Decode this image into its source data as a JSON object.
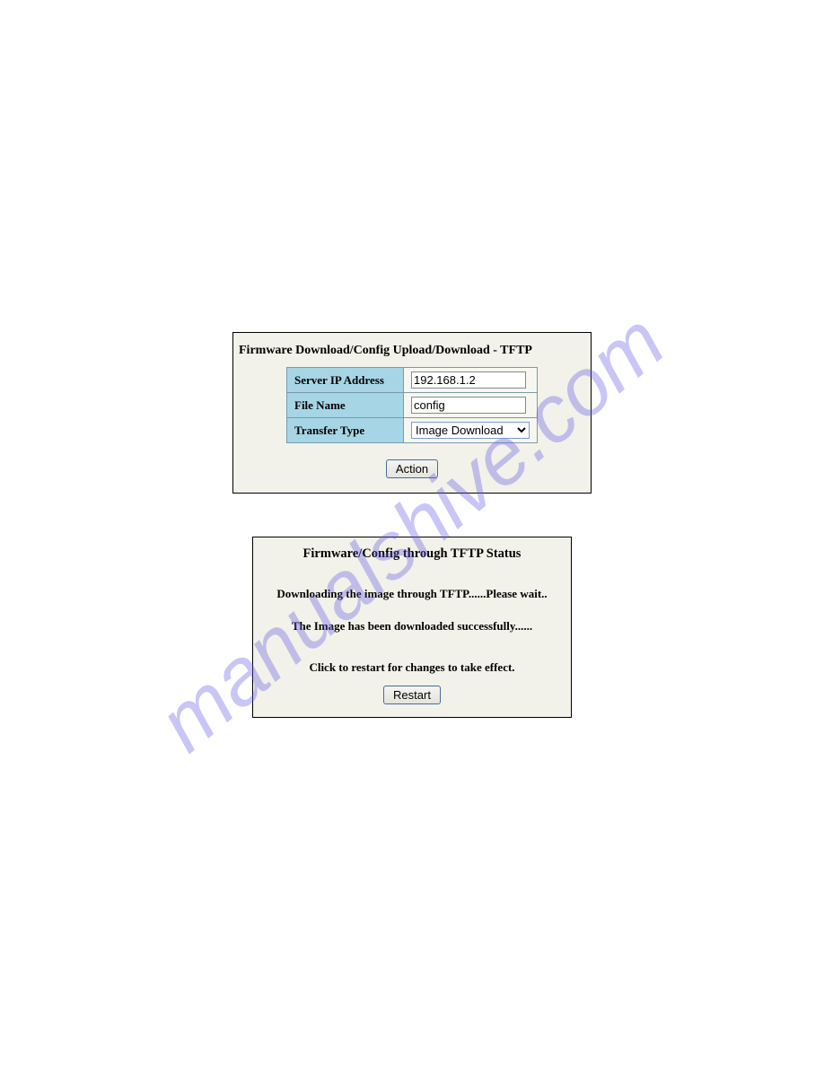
{
  "watermark": "manualshive.com",
  "panel1": {
    "title": "Firmware Download/Config Upload/Download - TFTP",
    "fields": {
      "server_ip_label": "Server IP Address",
      "server_ip_value": "192.168.1.2",
      "file_name_label": "File Name",
      "file_name_value": "config",
      "transfer_type_label": "Transfer Type",
      "transfer_type_value": "Image Download"
    },
    "action_label": "Action"
  },
  "panel2": {
    "title": "Firmware/Config through TFTP Status",
    "status1": "Downloading the image through TFTP......Please wait..",
    "status2": "The Image has been downloaded successfully......",
    "restart_hint": "Click to restart for changes to take effect.",
    "restart_label": "Restart"
  }
}
